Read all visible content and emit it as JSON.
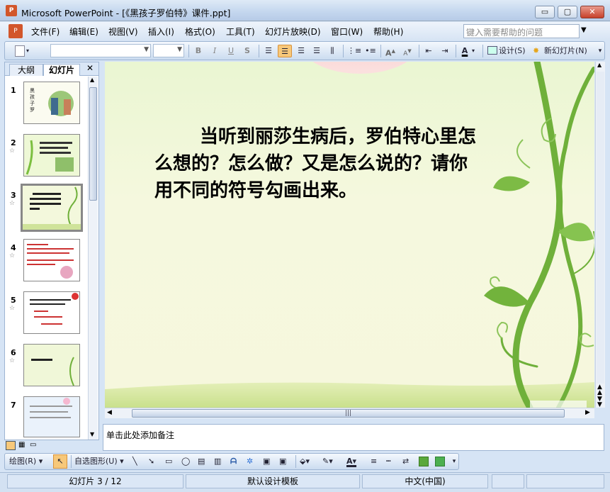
{
  "window": {
    "app_icon_label": "P",
    "title": "Microsoft PowerPoint - [《黑孩子罗伯特》课件.ppt]",
    "minimize_glyph": "▭",
    "maximize_glyph": "▢",
    "close_glyph": "✕"
  },
  "menubar": {
    "items": [
      "文件(F)",
      "编辑(E)",
      "视图(V)",
      "插入(I)",
      "格式(O)",
      "工具(T)",
      "幻灯片放映(D)",
      "窗口(W)",
      "帮助(H)"
    ],
    "help_placeholder": "键入需要帮助的问题"
  },
  "toolbar": {
    "bold": "B",
    "italic": "I",
    "underline": "U",
    "shadow": "S",
    "font_color": "A",
    "design_label": "设计(S)",
    "new_slide_label": "新幻灯片(N)",
    "grow_font": "A",
    "shrink_font": "A"
  },
  "left_pane": {
    "tabs": [
      "大纲",
      "幻灯片"
    ],
    "close_glyph": "✕",
    "thumbnails": [
      {
        "num": "1",
        "star": ""
      },
      {
        "num": "2",
        "star": "☆"
      },
      {
        "num": "3",
        "star": "☆"
      },
      {
        "num": "4",
        "star": "☆"
      },
      {
        "num": "5",
        "star": "☆"
      },
      {
        "num": "6",
        "star": "☆"
      },
      {
        "num": "7",
        "star": ""
      }
    ],
    "selected_slide": 3
  },
  "slide": {
    "text": "当听到丽莎生病后，罗伯特心里怎么想的？怎么做？又是怎么说的？请你用不同的符号勾画出来。"
  },
  "notes": {
    "placeholder": "单击此处添加备注"
  },
  "drawbar": {
    "draw_label": "绘图(R)",
    "autoshape_label": "自选图形(U)",
    "font_color": "A"
  },
  "statusbar": {
    "slide_position": "幻灯片 3 / 12",
    "template": "默认设计模板",
    "language": "中文(中国)"
  },
  "colors": {
    "accent": "#f7a94a",
    "pane_border": "#9eb5d3",
    "vine": "#6fb03a"
  },
  "hscroll_grip": "|||"
}
